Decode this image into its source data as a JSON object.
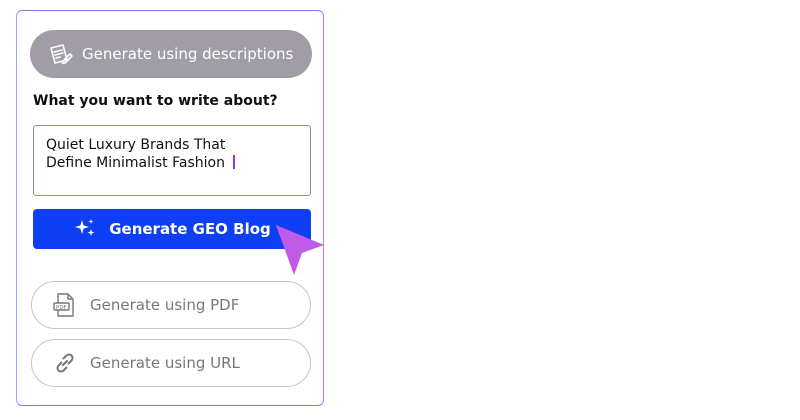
{
  "buttons": {
    "descriptions_label": "Generate using descriptions",
    "generate_geo_label": "Generate GEO Blog",
    "pdf_label": "Generate using PDF",
    "url_label": "Generate using URL"
  },
  "prompt": {
    "label": "What you want to write about?",
    "value": "Quiet Luxury Brands That\nDefine Minimalist Fashion"
  },
  "icons": {
    "descriptions": "document-edit-icon",
    "generate": "sparkle-icon",
    "pdf": "pdf-file-icon",
    "url": "link-icon",
    "pointer": "cursor-arrow-icon"
  },
  "colors": {
    "primary": "#0f3ff4",
    "muted_button": "#a19da6",
    "cursor": "#c05be8",
    "caret": "#9b35e0"
  }
}
